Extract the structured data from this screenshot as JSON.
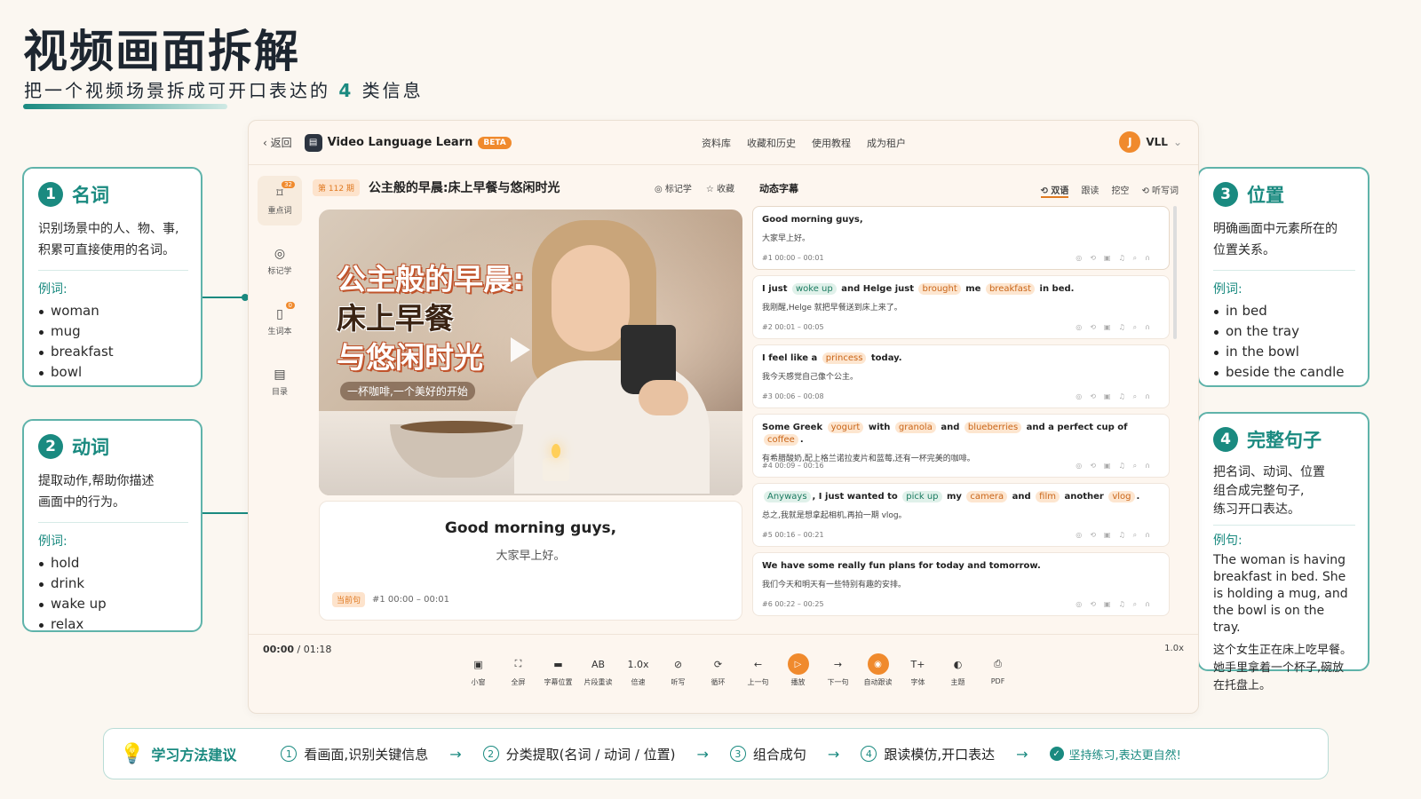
{
  "header": {
    "title": "视频画面拆解",
    "subtitle_pre": "把一个视频场景拆成可开口表达的",
    "subtitle_num": "4",
    "subtitle_post": "类信息"
  },
  "cards": {
    "nouns": {
      "num": "1",
      "title": "名词",
      "desc1": "识别场景中的人、物、事,",
      "desc2": "积累可直接使用的名词。",
      "label": "例词:",
      "items": [
        "woman",
        "mug",
        "breakfast",
        "bowl"
      ]
    },
    "verbs": {
      "num": "2",
      "title": "动词",
      "desc1": "提取动作,帮助你描述",
      "desc2": "画面中的行为。",
      "label": "例词:",
      "items": [
        "hold",
        "drink",
        "wake up",
        "relax"
      ]
    },
    "positions": {
      "num": "3",
      "title": "位置",
      "desc1": "明确画面中元素所在的",
      "desc2": "位置关系。",
      "label": "例词:",
      "items": [
        "in bed",
        "on the tray",
        "in the bowl",
        "beside the candle"
      ]
    },
    "sentence": {
      "num": "4",
      "title": "完整句子",
      "desc1": "把名词、动词、位置",
      "desc2": "组合成完整句子,",
      "desc3": "练习开口表达。",
      "label": "例句:",
      "en": "The woman is having breakfast in bed. She is holding a mug, and the bowl is on the tray.",
      "zh": "这个女生正在床上吃早餐。她手里拿着一个杯子,碗放在托盘上。"
    }
  },
  "app": {
    "back": "返回",
    "name": "Video Language Learn",
    "beta": "BETA",
    "nav": [
      "资料库",
      "收藏和历史",
      "使用教程",
      "成为租户"
    ],
    "user_initial": "J",
    "user_name": "VLL",
    "sidebar": [
      {
        "label": "重点词",
        "icon": "bookmark-icon",
        "count": "32"
      },
      {
        "label": "标记学",
        "icon": "target-icon"
      },
      {
        "label": "生词本",
        "icon": "notebook-icon",
        "count": "0"
      },
      {
        "label": "目录",
        "icon": "catalog-icon"
      }
    ],
    "episode_tag": "第 112 期",
    "episode_title": "公主般的早晨:床上早餐与悠闲时光",
    "ep_actions": [
      "◎ 标记学",
      "☆ 收藏"
    ],
    "video": {
      "line1": "公主般的早晨:",
      "line2": "床上早餐",
      "line3": "与悠闲时光",
      "tag": "一杯咖啡,一个美好的开始"
    },
    "current": {
      "en": "Good morning guys,",
      "zh": "大家早上好。",
      "badge": "当前句",
      "meta": "#1  00:00 – 00:01"
    },
    "panel_title": "动态字幕",
    "panel_tabs": [
      "⟲ 双语",
      "跟读",
      "挖空",
      "⟲ 听写词"
    ],
    "subtitles": [
      {
        "en_html": "Good morning guys,",
        "zh": "大家早上好。",
        "meta": "#1    00:00 – 00:01"
      },
      {
        "en_html": "I just <span class=\"kw g\">woke up</span> and Helge just <span class=\"kw\">brought</span> me <span class=\"kw\">breakfast</span> in bed.",
        "zh": "我刚醒,Helge 就把早餐送到床上来了。",
        "meta": "#2    00:01 – 00:05"
      },
      {
        "en_html": "I feel like a <span class=\"kw\">princess</span> today.",
        "zh": "我今天感觉自己像个公主。",
        "meta": "#3    00:06 – 00:08"
      },
      {
        "en_html": "Some Greek <span class=\"kw\">yogurt</span> with <span class=\"kw\">granola</span> and <span class=\"kw\">blueberries</span> and a perfect cup of <span class=\"kw\">coffee</span>.",
        "zh": "有希腊酸奶,配上格兰诺拉麦片和蓝莓,还有一杯完美的咖啡。",
        "meta": "#4    00:09 – 00:16"
      },
      {
        "en_html": "<span class=\"kw g\">Anyways</span>, I just wanted to <span class=\"kw g\">pick up</span> my <span class=\"kw\">camera</span> and <span class=\"kw\">film</span> another <span class=\"kw\">vlog</span>.",
        "zh": "总之,我就是想拿起相机,再拍一期 vlog。",
        "meta": "#5    00:16 – 00:21"
      },
      {
        "en_html": "We have some really fun plans for today and tomorrow.",
        "zh": "我们今天和明天有一些特别有趣的安排。",
        "meta": "#6    00:22 – 00:25"
      }
    ],
    "time_current": "00:00",
    "time_total": " / 01:18",
    "speed": "1.0x",
    "controls": [
      {
        "icon": "▣",
        "label": "小窗",
        "name": "mini-window-button"
      },
      {
        "icon": "⛶",
        "label": "全屏",
        "name": "fullscreen-button"
      },
      {
        "icon": "▬",
        "label": "字幕位置",
        "name": "subtitle-position-button"
      },
      {
        "icon": "AB",
        "label": "片段重读",
        "name": "ab-repeat-button"
      },
      {
        "icon": "1.0x",
        "label": "倍速",
        "name": "speed-button"
      },
      {
        "icon": "⊘",
        "label": "听写",
        "name": "dictation-button"
      },
      {
        "icon": "⟳",
        "label": "循环",
        "name": "loop-button"
      },
      {
        "icon": "←",
        "label": "上一句",
        "name": "prev-sentence-button"
      },
      {
        "icon": "▷",
        "label": "播放",
        "name": "play-button",
        "play": true
      },
      {
        "icon": "→",
        "label": "下一句",
        "name": "next-sentence-button"
      },
      {
        "icon": "◉",
        "label": "自动跟读",
        "name": "auto-shadow-button",
        "play": true
      },
      {
        "icon": "T+",
        "label": "字体",
        "name": "font-button"
      },
      {
        "icon": "◐",
        "label": "主题",
        "name": "theme-button"
      },
      {
        "icon": "⎙",
        "label": "PDF",
        "name": "pdf-button"
      }
    ]
  },
  "tips": {
    "title": "学习方法建议",
    "steps": [
      "看画面,识别关键信息",
      "分类提取(名词 / 动词 / 位置)",
      "组合成句",
      "跟读模仿,开口表达"
    ],
    "end": "坚持练习,表达更自然!"
  },
  "colors": {
    "accent": "#1a8a80",
    "orange": "#f08a2d"
  }
}
